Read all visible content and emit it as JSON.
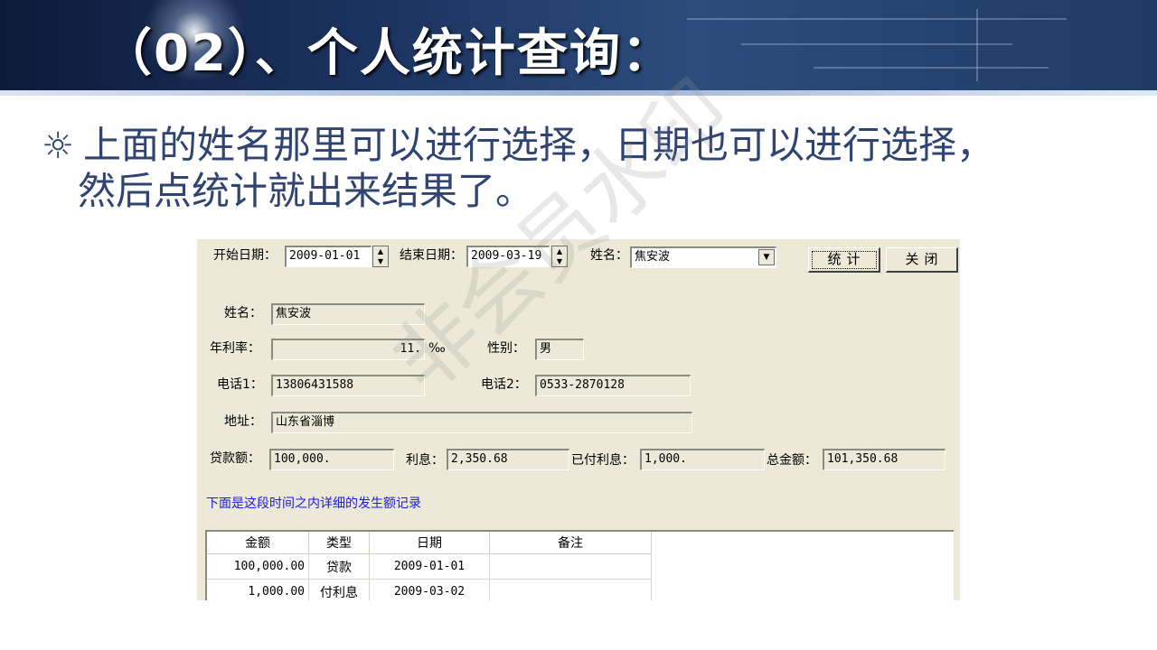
{
  "slide": {
    "title": "（02）、个人统计查询：",
    "bullet_symbol": "☼",
    "bullet_line1": "上面的姓名那里可以进行选择，日期也可以进行选择，",
    "bullet_line2": "然后点统计就出来结果了。",
    "watermark": "非会员水印"
  },
  "form": {
    "start_date_label": "开始日期：",
    "start_date_value": "2009-01-01",
    "end_date_label": "结束日期：",
    "end_date_value": "2009-03-19",
    "name_select_label": "姓名：",
    "name_select_value": "焦安波",
    "stat_button": "统计",
    "close_button": "关闭",
    "name_label": "姓名：",
    "name_value": "焦安波",
    "rate_label": "年利率：",
    "rate_value": "11.",
    "rate_unit": "‰",
    "gender_label": "性别：",
    "gender_value": "男",
    "phone1_label": "电话1：",
    "phone1_value": "13806431588",
    "phone2_label": "电话2：",
    "phone2_value": "0533-2870128",
    "address_label": "地址：",
    "address_value": "山东省淄博",
    "loan_label": "贷款额：",
    "loan_value": "100,000.",
    "interest_label": "利息：",
    "interest_value": "2,350.68",
    "paid_interest_label": "已付利息：",
    "paid_interest_value": "1,000.",
    "total_label": "总金额：",
    "total_value": "101,350.68",
    "detail_note": "下面是这段时间之内详细的发生额记录"
  },
  "records": {
    "headers": [
      "金额",
      "类型",
      "日期",
      "备注"
    ],
    "rows": [
      [
        "100,000.00",
        "贷款",
        "2009-01-01",
        ""
      ],
      [
        "1,000.00",
        "付利息",
        "2009-03-02",
        ""
      ]
    ]
  }
}
